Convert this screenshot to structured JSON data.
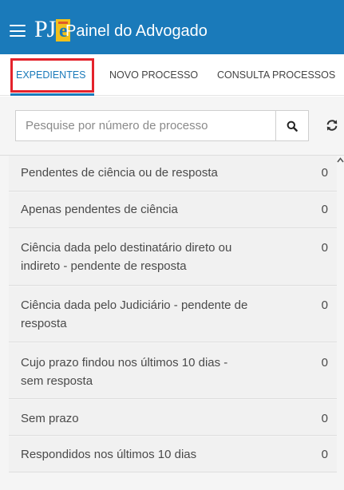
{
  "header": {
    "app_title": "Painel do Advogado",
    "logo_text_pj": "PJ",
    "logo_text_e": "e",
    "background_color": "#1a7aba",
    "menu_icon": "hamburger-menu-icon"
  },
  "tabs": [
    {
      "label": "EXPEDIENTES",
      "active": true
    },
    {
      "label": "NOVO PROCESSO",
      "active": false
    },
    {
      "label": "CONSULTA PROCESSOS",
      "active": false
    }
  ],
  "search": {
    "placeholder": "Pesquise por número de processo",
    "value": "",
    "search_icon": "search-icon",
    "refresh_icon": "refresh-icon"
  },
  "items": [
    {
      "label": "Pendentes de ciência ou de resposta",
      "count": "0"
    },
    {
      "label": "Apenas pendentes de ciência",
      "count": "0"
    },
    {
      "label": "Ciência dada pelo destinatário direto ou indireto - pendente de resposta",
      "count": "0"
    },
    {
      "label": "Ciência dada pelo Judiciário - pendente de resposta",
      "count": "0"
    },
    {
      "label": "Cujo prazo findou nos últimos 10 dias - sem resposta",
      "count": "0"
    },
    {
      "label": "Sem prazo",
      "count": "0"
    },
    {
      "label": "Respondidos nos últimos 10 dias",
      "count": "0"
    }
  ],
  "colors": {
    "accent": "#1a7aba",
    "highlight_box": "#e4222b",
    "logo_yellow": "#f2c11b"
  }
}
